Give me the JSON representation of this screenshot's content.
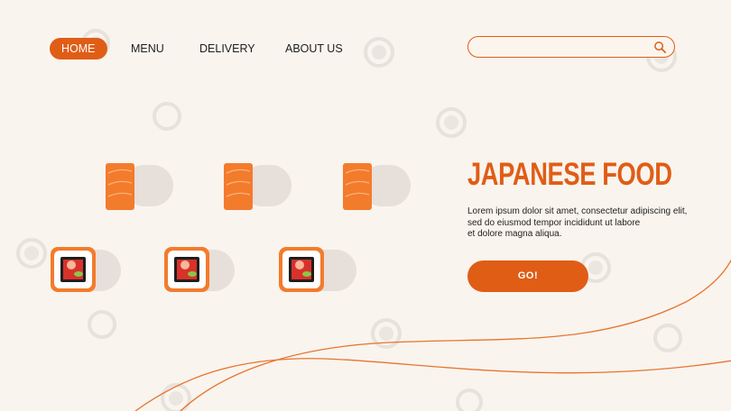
{
  "nav": {
    "items": [
      {
        "label": "HOME",
        "active": true
      },
      {
        "label": "MENU",
        "active": false
      },
      {
        "label": "DELIVERY",
        "active": false
      },
      {
        "label": "ABOUT US",
        "active": false
      }
    ]
  },
  "search": {
    "placeholder": "",
    "value": ""
  },
  "hero": {
    "title": "JAPANESE FOOD",
    "description_lines": [
      "Lorem ipsum dolor sit amet, consectetur adipiscing elit,",
      "sed do eiusmod tempor incididunt ut labore",
      "et dolore magna aliqua."
    ],
    "cta_label": "GO!"
  },
  "colors": {
    "accent": "#e05d16",
    "background": "#f9f4ee",
    "salmon": "#f37b2c",
    "tuna": "#d8322a",
    "nori": "#1e1e1e",
    "cucumber": "#8fc34a"
  },
  "products": {
    "nigiri_count": 3,
    "rolls_count": 3
  }
}
